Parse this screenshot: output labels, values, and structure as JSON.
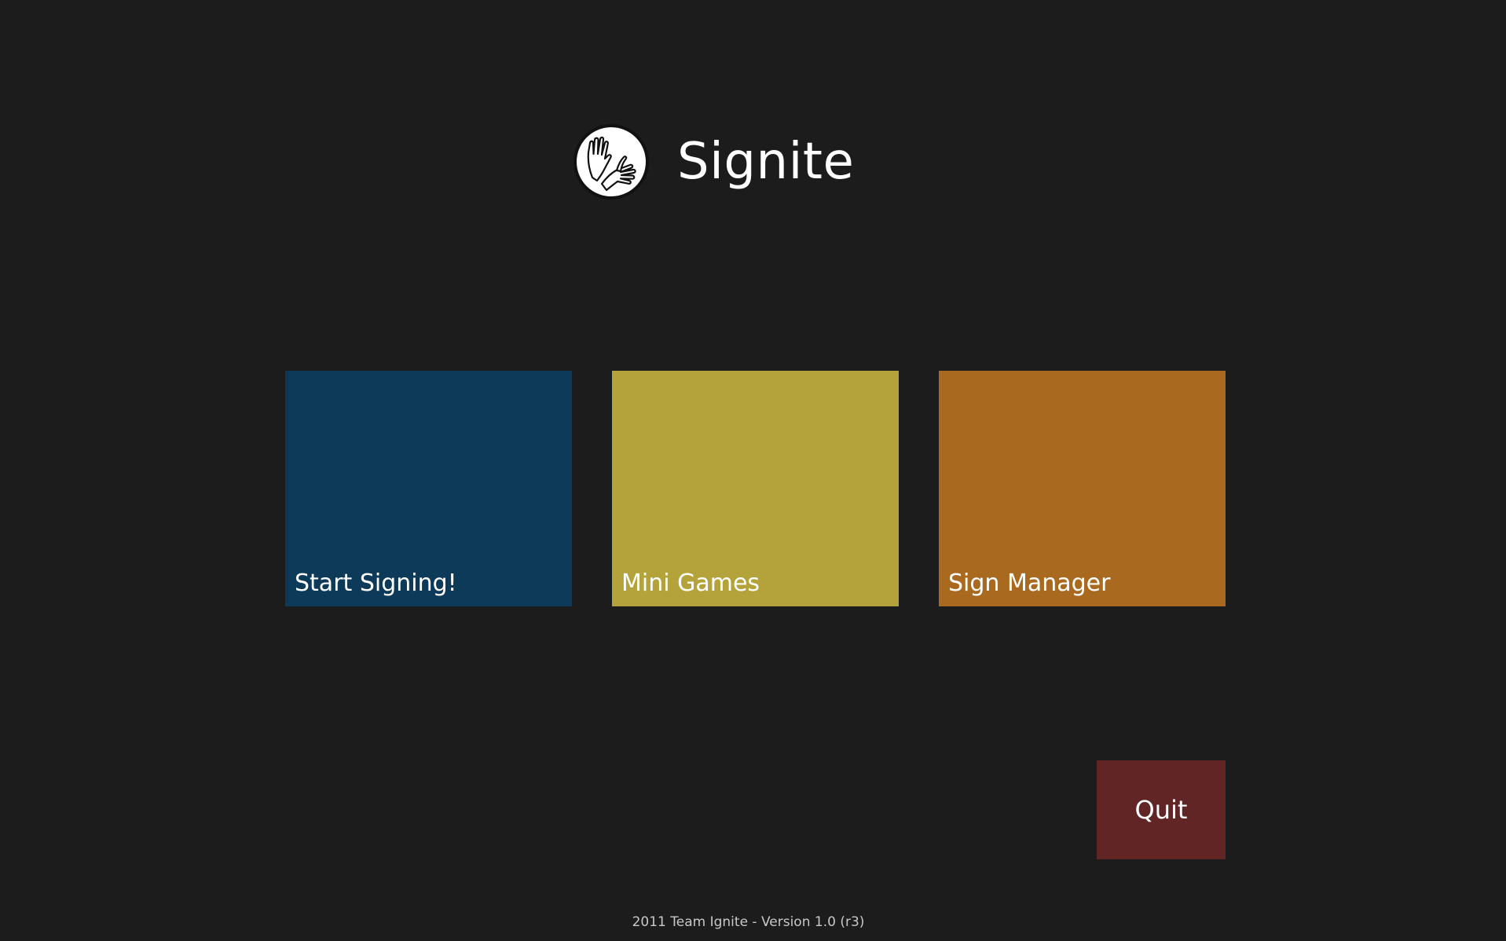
{
  "app": {
    "title": "Signite",
    "logo_icon": "signing-hands-icon"
  },
  "tiles": [
    {
      "id": "start",
      "label": "Start Signing!",
      "color": "#0e3a5a"
    },
    {
      "id": "games",
      "label": "Mini Games",
      "color": "#b3a33a"
    },
    {
      "id": "manager",
      "label": "Sign Manager",
      "color": "#a96a20"
    }
  ],
  "quit": {
    "label": "Quit",
    "color": "#612525"
  },
  "footer": {
    "text": "2011 Team Ignite - Version 1.0 (r3)"
  },
  "theme": {
    "background": "#1c1c1c",
    "text": "#ffffff"
  }
}
